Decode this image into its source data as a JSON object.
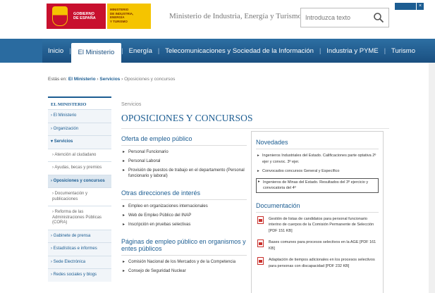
{
  "header": {
    "gov_logo_text": "GOBIERNO\nDE ESPAÑA",
    "ministry_logo_text": "MINISTERIO\nDE INDUSTRIA, ENERGÍA\nY TURISMO",
    "site_title": "Ministerio de Industria, Energía y Turismo",
    "search_placeholder": "Introduzca texto"
  },
  "nav": {
    "items": [
      {
        "label": "Inicio"
      },
      {
        "label": "El Ministerio"
      },
      {
        "label": "Energía"
      },
      {
        "label": "Telecomunicaciones y Sociedad de la Información"
      },
      {
        "label": "Industria y PYME"
      },
      {
        "label": "Turismo"
      }
    ]
  },
  "breadcrumb": {
    "prefix": "Estás en:",
    "items": [
      "El Ministerio",
      "Servicios"
    ],
    "current": "Oposiciones y concursos"
  },
  "sidebar": {
    "header": "EL MINISTERIO",
    "items": [
      {
        "label": "El Ministerio"
      },
      {
        "label": "Organización"
      },
      {
        "label": "Servicios"
      },
      {
        "label": "Atención al ciudadano"
      },
      {
        "label": "Ayudas, becas y premios"
      },
      {
        "label": "Oposiciones y concursos"
      },
      {
        "label": "Documentación y publicaciones"
      },
      {
        "label": "Reforma de las Administraciones Públicas (CORA)"
      },
      {
        "label": "Gabinete de prensa"
      },
      {
        "label": "Estadísticas e informes"
      },
      {
        "label": "Sede Electrónica"
      },
      {
        "label": "Redes sociales y blogs"
      }
    ]
  },
  "main": {
    "section_label": "Servicios",
    "title": "OPOSICIONES Y CONCURSOS",
    "blocks": [
      {
        "heading": "Oferta de empleo público",
        "links": [
          "Personal Funcionario",
          "Personal Laboral",
          "Provisión de puestos de trabajo en el departamento (Personal funcionario y laboral)"
        ]
      },
      {
        "heading": "Otras direcciones de interés",
        "links": [
          "Empleo en organizaciones internacionales",
          "Web de Empleo Público del INAP",
          "Inscripción en pruebas selectivas"
        ]
      },
      {
        "heading": "Páginas de empleo público en organismos y entes públicos",
        "links": [
          "Comisión Nacional de los Mercados y de la Competencia",
          "Consejo de Seguridad Nuclear"
        ]
      }
    ]
  },
  "aside": {
    "novedades_heading": "Novedades",
    "novedades": [
      "Ingenieros Industriales del Estado. Calificaciones parte optativa 2º ejer y convoc. 3º ejer.",
      "Convocados concursos General y Específico",
      "Ingenieros de Minas del Estado. Resultados del 3º ejercicio y convocatoria del 4º"
    ],
    "documentacion_heading": "Documentación",
    "documentos": [
      "Gestión de listas de candidatos para personal funcionario interino de cuerpos de la Comisión Permanente de Selección [PDF 151 KB]",
      "Bases comunes para procesos selectivos en la AGE [PDF 161 KB]",
      "Adaptación de tiempos adicionales en los procesos selectivos para personas con discapacidad [PDF 232 KB]"
    ]
  },
  "colors": {
    "brand_blue": "#1c5d92",
    "gov_red": "#c8102e",
    "gov_yellow": "#f5c400"
  }
}
